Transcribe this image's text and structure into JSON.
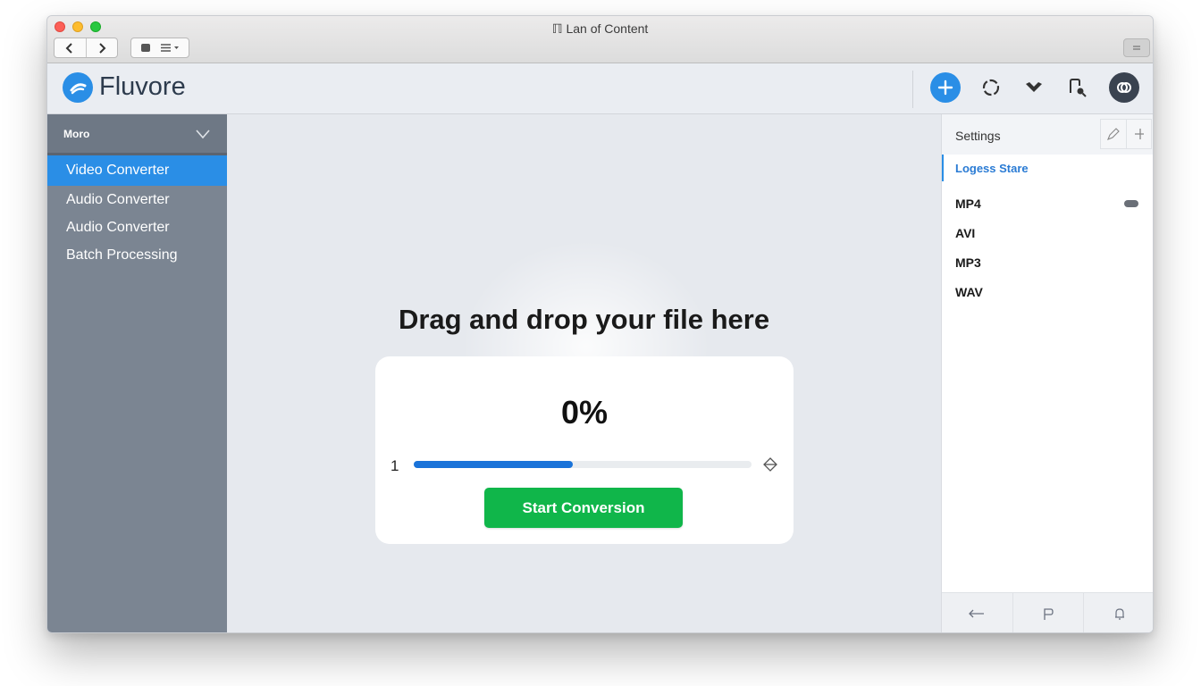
{
  "window": {
    "title": "ℿ Lan of Content"
  },
  "brand": {
    "name": "Fluvore",
    "accent": "#2a8ee6"
  },
  "header_actions": [
    {
      "icon": "plus-icon"
    },
    {
      "icon": "sync-icon"
    },
    {
      "icon": "download-icon"
    },
    {
      "icon": "search-icon"
    },
    {
      "icon": "profile-icon"
    }
  ],
  "sidebar": {
    "header_label": "Moro",
    "items": [
      {
        "label": "Video Converter",
        "active": true
      },
      {
        "label": "Audio Converter",
        "active": false
      },
      {
        "label": "Audio Converter",
        "active": false
      },
      {
        "label": "Batch Processing",
        "active": false
      }
    ]
  },
  "main": {
    "drop_title": "Drag and drop your file here",
    "progress_label": "0%",
    "file_count": "1",
    "progress_fraction": 0.47,
    "start_button": "Start Conversion",
    "progress_color": "#1a73d9",
    "button_color": "#10b64a"
  },
  "settings": {
    "title": "Settings",
    "section_label": "Logess Stare",
    "formats": [
      {
        "label": "MP4",
        "toggle": true
      },
      {
        "label": "AVI",
        "toggle": false
      },
      {
        "label": "MP3",
        "toggle": false
      },
      {
        "label": "WAV",
        "toggle": false
      }
    ]
  }
}
